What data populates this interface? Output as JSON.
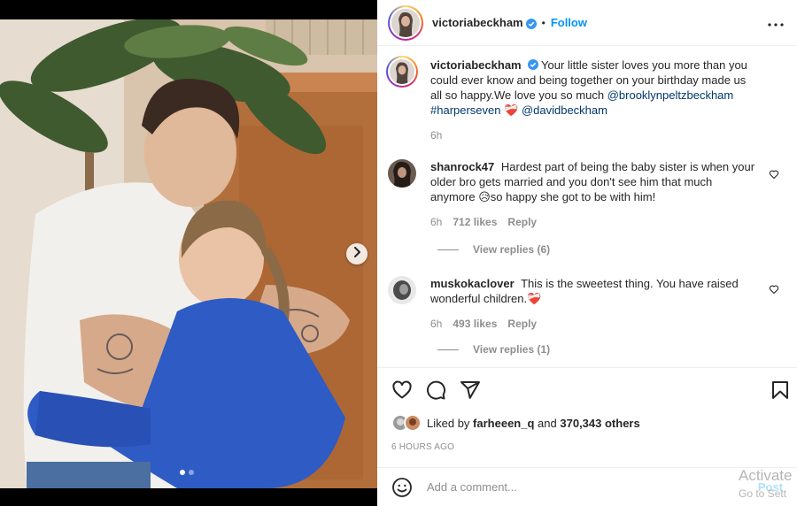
{
  "post": {
    "author": "victoriabeckham",
    "separator": "•",
    "follow_label": "Follow",
    "image_dots": 2,
    "active_dot": 0
  },
  "caption": {
    "username": "victoriabeckham",
    "text": "Your little sister loves you more than you could ever know and being together on your birthday made us all so happy.We love you so much",
    "mention_1": "@brooklynpeltzbeckham",
    "hashtag": "#harperseven",
    "emoji": "❤️‍🩹",
    "mention_2": "@davidbeckham",
    "time": "6h"
  },
  "comments": [
    {
      "username": "shanrock47",
      "text": "Hardest part of being the baby sister is when your older bro gets married and you don't see him that much anymore 😥so happy she got to be with him!",
      "time": "6h",
      "likes": "712 likes",
      "reply_label": "Reply",
      "view_replies": "View replies (6)"
    },
    {
      "username": "muskokaclover",
      "text": "This is the sweetest thing. You have raised wonderful children.❤️‍🩹",
      "time": "6h",
      "likes": "493 likes",
      "reply_label": "Reply",
      "view_replies": "View replies (1)"
    }
  ],
  "likes": {
    "prefix": "Liked by",
    "user": "farheeen_q",
    "middle": "and",
    "others": "370,343 others"
  },
  "timestamp": "6 HOURS AGO",
  "add_comment": {
    "placeholder": "Add a comment...",
    "post_label": "Post"
  },
  "watermark": {
    "line1": "Activate",
    "line2": "Go to Sett"
  },
  "icons": {
    "verified": "verified-badge-icon",
    "more": "more-options-icon",
    "like": "heart-icon",
    "comment": "comment-icon",
    "share": "share-icon",
    "save": "bookmark-icon",
    "emoji": "emoji-icon",
    "next": "chevron-right-icon"
  },
  "colors": {
    "link": "#00376b",
    "follow": "#0095f6",
    "muted": "#8e8e8e",
    "verified": "#3897f0",
    "post_disabled": "#b2dffc"
  }
}
